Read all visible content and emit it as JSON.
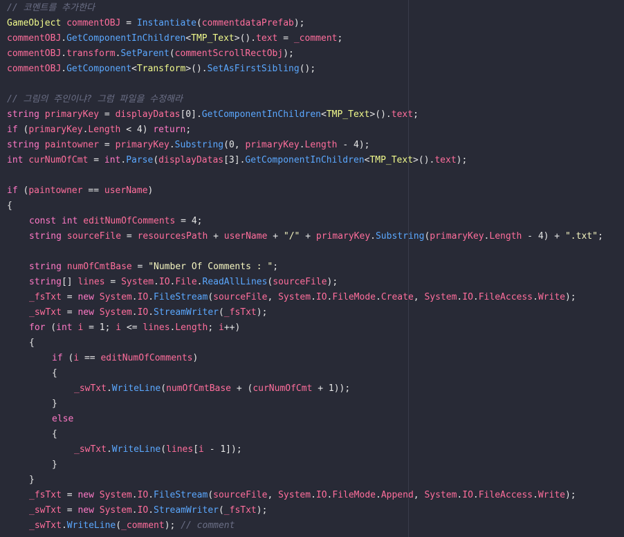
{
  "colors": {
    "background": "#282a36",
    "comment": "#6b6f86",
    "keyword": "#ff79c6",
    "type": "#f1fa8c",
    "variable": "#ff6e9c",
    "method": "#5ba8ff",
    "plain": "#e6e6e6"
  },
  "code_lines": [
    {
      "indent": 0,
      "tokens": [
        {
          "t": "// 코멘트를 추가한다",
          "c": "cm"
        }
      ]
    },
    {
      "indent": 0,
      "tokens": [
        {
          "t": "GameObject",
          "c": "ty"
        },
        {
          "t": " ",
          "c": "pl"
        },
        {
          "t": "commentOBJ",
          "c": "vr"
        },
        {
          "t": " = ",
          "c": "op"
        },
        {
          "t": "Instantiate",
          "c": "fn"
        },
        {
          "t": "(",
          "c": "pl"
        },
        {
          "t": "commentdataPrefab",
          "c": "vr"
        },
        {
          "t": ");",
          "c": "pl"
        }
      ]
    },
    {
      "indent": 0,
      "tokens": [
        {
          "t": "commentOBJ",
          "c": "vr"
        },
        {
          "t": ".",
          "c": "pl"
        },
        {
          "t": "GetComponentInChildren",
          "c": "fn"
        },
        {
          "t": "<",
          "c": "pl"
        },
        {
          "t": "TMP_Text",
          "c": "ty"
        },
        {
          "t": ">().",
          "c": "pl"
        },
        {
          "t": "text",
          "c": "vr"
        },
        {
          "t": " = ",
          "c": "op"
        },
        {
          "t": "_comment",
          "c": "vr"
        },
        {
          "t": ";",
          "c": "pl"
        }
      ]
    },
    {
      "indent": 0,
      "tokens": [
        {
          "t": "commentOBJ",
          "c": "vr"
        },
        {
          "t": ".",
          "c": "pl"
        },
        {
          "t": "transform",
          "c": "vr"
        },
        {
          "t": ".",
          "c": "pl"
        },
        {
          "t": "SetParent",
          "c": "fn"
        },
        {
          "t": "(",
          "c": "pl"
        },
        {
          "t": "commentScrollRectObj",
          "c": "vr"
        },
        {
          "t": ");",
          "c": "pl"
        }
      ]
    },
    {
      "indent": 0,
      "tokens": [
        {
          "t": "commentOBJ",
          "c": "vr"
        },
        {
          "t": ".",
          "c": "pl"
        },
        {
          "t": "GetComponent",
          "c": "fn"
        },
        {
          "t": "<",
          "c": "pl"
        },
        {
          "t": "Transform",
          "c": "ty"
        },
        {
          "t": ">().",
          "c": "pl"
        },
        {
          "t": "SetAsFirstSibling",
          "c": "fn"
        },
        {
          "t": "();",
          "c": "pl"
        }
      ]
    },
    {
      "indent": 0,
      "tokens": []
    },
    {
      "indent": 0,
      "tokens": [
        {
          "t": "// 그림의 주인이냐? 그럼 파일을 수정해라",
          "c": "cm"
        }
      ]
    },
    {
      "indent": 0,
      "tokens": [
        {
          "t": "string",
          "c": "kw"
        },
        {
          "t": " ",
          "c": "pl"
        },
        {
          "t": "primaryKey",
          "c": "vr"
        },
        {
          "t": " = ",
          "c": "op"
        },
        {
          "t": "displayDatas",
          "c": "vr"
        },
        {
          "t": "[0].",
          "c": "pl"
        },
        {
          "t": "GetComponentInChildren",
          "c": "fn"
        },
        {
          "t": "<",
          "c": "pl"
        },
        {
          "t": "TMP_Text",
          "c": "ty"
        },
        {
          "t": ">().",
          "c": "pl"
        },
        {
          "t": "text",
          "c": "vr"
        },
        {
          "t": ";",
          "c": "pl"
        }
      ]
    },
    {
      "indent": 0,
      "tokens": [
        {
          "t": "if",
          "c": "kw"
        },
        {
          "t": " (",
          "c": "pl"
        },
        {
          "t": "primaryKey",
          "c": "vr"
        },
        {
          "t": ".",
          "c": "pl"
        },
        {
          "t": "Length",
          "c": "vr"
        },
        {
          "t": " < 4) ",
          "c": "pl"
        },
        {
          "t": "return",
          "c": "kw"
        },
        {
          "t": ";",
          "c": "pl"
        }
      ]
    },
    {
      "indent": 0,
      "tokens": [
        {
          "t": "string",
          "c": "kw"
        },
        {
          "t": " ",
          "c": "pl"
        },
        {
          "t": "paintowner",
          "c": "vr"
        },
        {
          "t": " = ",
          "c": "op"
        },
        {
          "t": "primaryKey",
          "c": "vr"
        },
        {
          "t": ".",
          "c": "pl"
        },
        {
          "t": "Substring",
          "c": "fn"
        },
        {
          "t": "(0, ",
          "c": "pl"
        },
        {
          "t": "primaryKey",
          "c": "vr"
        },
        {
          "t": ".",
          "c": "pl"
        },
        {
          "t": "Length",
          "c": "vr"
        },
        {
          "t": " - 4);",
          "c": "pl"
        }
      ]
    },
    {
      "indent": 0,
      "tokens": [
        {
          "t": "int",
          "c": "kw"
        },
        {
          "t": " ",
          "c": "pl"
        },
        {
          "t": "curNumOfCmt",
          "c": "vr"
        },
        {
          "t": " = ",
          "c": "op"
        },
        {
          "t": "int",
          "c": "kw"
        },
        {
          "t": ".",
          "c": "pl"
        },
        {
          "t": "Parse",
          "c": "fn"
        },
        {
          "t": "(",
          "c": "pl"
        },
        {
          "t": "displayDatas",
          "c": "vr"
        },
        {
          "t": "[3].",
          "c": "pl"
        },
        {
          "t": "GetComponentInChildren",
          "c": "fn"
        },
        {
          "t": "<",
          "c": "pl"
        },
        {
          "t": "TMP_Text",
          "c": "ty"
        },
        {
          "t": ">().",
          "c": "pl"
        },
        {
          "t": "text",
          "c": "vr"
        },
        {
          "t": ");",
          "c": "pl"
        }
      ]
    },
    {
      "indent": 0,
      "tokens": []
    },
    {
      "indent": 0,
      "tokens": [
        {
          "t": "if",
          "c": "kw"
        },
        {
          "t": " (",
          "c": "pl"
        },
        {
          "t": "paintowner",
          "c": "vr"
        },
        {
          "t": " == ",
          "c": "op"
        },
        {
          "t": "userName",
          "c": "vr"
        },
        {
          "t": ")",
          "c": "pl"
        }
      ]
    },
    {
      "indent": 0,
      "tokens": [
        {
          "t": "{",
          "c": "pl"
        }
      ]
    },
    {
      "indent": 1,
      "tokens": [
        {
          "t": "const",
          "c": "kw"
        },
        {
          "t": " ",
          "c": "pl"
        },
        {
          "t": "int",
          "c": "kw"
        },
        {
          "t": " ",
          "c": "pl"
        },
        {
          "t": "editNumOfComments",
          "c": "vr"
        },
        {
          "t": " = 4;",
          "c": "pl"
        }
      ]
    },
    {
      "indent": 1,
      "tokens": [
        {
          "t": "string",
          "c": "kw"
        },
        {
          "t": " ",
          "c": "pl"
        },
        {
          "t": "sourceFile",
          "c": "vr"
        },
        {
          "t": " = ",
          "c": "op"
        },
        {
          "t": "resourcesPath",
          "c": "vr"
        },
        {
          "t": " + ",
          "c": "op"
        },
        {
          "t": "userName",
          "c": "vr"
        },
        {
          "t": " + ",
          "c": "op"
        },
        {
          "t": "\"/\"",
          "c": "st"
        },
        {
          "t": " + ",
          "c": "op"
        },
        {
          "t": "primaryKey",
          "c": "vr"
        },
        {
          "t": ".",
          "c": "pl"
        },
        {
          "t": "Substring",
          "c": "fn"
        },
        {
          "t": "(",
          "c": "pl"
        },
        {
          "t": "primaryKey",
          "c": "vr"
        },
        {
          "t": ".",
          "c": "pl"
        },
        {
          "t": "Length",
          "c": "vr"
        },
        {
          "t": " - 4) + ",
          "c": "pl"
        },
        {
          "t": "\".txt\"",
          "c": "st"
        },
        {
          "t": ";",
          "c": "pl"
        }
      ]
    },
    {
      "indent": 1,
      "tokens": []
    },
    {
      "indent": 1,
      "tokens": [
        {
          "t": "string",
          "c": "kw"
        },
        {
          "t": " ",
          "c": "pl"
        },
        {
          "t": "numOfCmtBase",
          "c": "vr"
        },
        {
          "t": " = ",
          "c": "op"
        },
        {
          "t": "\"Number Of Comments : \"",
          "c": "st"
        },
        {
          "t": ";",
          "c": "pl"
        }
      ]
    },
    {
      "indent": 1,
      "tokens": [
        {
          "t": "string",
          "c": "kw"
        },
        {
          "t": "[] ",
          "c": "pl"
        },
        {
          "t": "lines",
          "c": "vr"
        },
        {
          "t": " = ",
          "c": "op"
        },
        {
          "t": "System",
          "c": "vr"
        },
        {
          "t": ".",
          "c": "pl"
        },
        {
          "t": "IO",
          "c": "vr"
        },
        {
          "t": ".",
          "c": "pl"
        },
        {
          "t": "File",
          "c": "vr"
        },
        {
          "t": ".",
          "c": "pl"
        },
        {
          "t": "ReadAllLines",
          "c": "fn"
        },
        {
          "t": "(",
          "c": "pl"
        },
        {
          "t": "sourceFile",
          "c": "vr"
        },
        {
          "t": ");",
          "c": "pl"
        }
      ]
    },
    {
      "indent": 1,
      "tokens": [
        {
          "t": "_fsTxt",
          "c": "vr"
        },
        {
          "t": " = ",
          "c": "op"
        },
        {
          "t": "new",
          "c": "kw"
        },
        {
          "t": " ",
          "c": "pl"
        },
        {
          "t": "System",
          "c": "vr"
        },
        {
          "t": ".",
          "c": "pl"
        },
        {
          "t": "IO",
          "c": "vr"
        },
        {
          "t": ".",
          "c": "pl"
        },
        {
          "t": "FileStream",
          "c": "fn"
        },
        {
          "t": "(",
          "c": "pl"
        },
        {
          "t": "sourceFile",
          "c": "vr"
        },
        {
          "t": ", ",
          "c": "pl"
        },
        {
          "t": "System",
          "c": "vr"
        },
        {
          "t": ".",
          "c": "pl"
        },
        {
          "t": "IO",
          "c": "vr"
        },
        {
          "t": ".",
          "c": "pl"
        },
        {
          "t": "FileMode",
          "c": "vr"
        },
        {
          "t": ".",
          "c": "pl"
        },
        {
          "t": "Create",
          "c": "vr"
        },
        {
          "t": ", ",
          "c": "pl"
        },
        {
          "t": "System",
          "c": "vr"
        },
        {
          "t": ".",
          "c": "pl"
        },
        {
          "t": "IO",
          "c": "vr"
        },
        {
          "t": ".",
          "c": "pl"
        },
        {
          "t": "FileAccess",
          "c": "vr"
        },
        {
          "t": ".",
          "c": "pl"
        },
        {
          "t": "Write",
          "c": "vr"
        },
        {
          "t": ");",
          "c": "pl"
        }
      ]
    },
    {
      "indent": 1,
      "tokens": [
        {
          "t": "_swTxt",
          "c": "vr"
        },
        {
          "t": " = ",
          "c": "op"
        },
        {
          "t": "new",
          "c": "kw"
        },
        {
          "t": " ",
          "c": "pl"
        },
        {
          "t": "System",
          "c": "vr"
        },
        {
          "t": ".",
          "c": "pl"
        },
        {
          "t": "IO",
          "c": "vr"
        },
        {
          "t": ".",
          "c": "pl"
        },
        {
          "t": "StreamWriter",
          "c": "fn"
        },
        {
          "t": "(",
          "c": "pl"
        },
        {
          "t": "_fsTxt",
          "c": "vr"
        },
        {
          "t": ");",
          "c": "pl"
        }
      ]
    },
    {
      "indent": 1,
      "tokens": [
        {
          "t": "for",
          "c": "kw"
        },
        {
          "t": " (",
          "c": "pl"
        },
        {
          "t": "int",
          "c": "kw"
        },
        {
          "t": " ",
          "c": "pl"
        },
        {
          "t": "i",
          "c": "vr"
        },
        {
          "t": " = 1; ",
          "c": "pl"
        },
        {
          "t": "i",
          "c": "vr"
        },
        {
          "t": " <= ",
          "c": "op"
        },
        {
          "t": "lines",
          "c": "vr"
        },
        {
          "t": ".",
          "c": "pl"
        },
        {
          "t": "Length",
          "c": "vr"
        },
        {
          "t": "; ",
          "c": "pl"
        },
        {
          "t": "i",
          "c": "vr"
        },
        {
          "t": "++)",
          "c": "pl"
        }
      ]
    },
    {
      "indent": 1,
      "tokens": [
        {
          "t": "{",
          "c": "pl"
        }
      ]
    },
    {
      "indent": 2,
      "tokens": [
        {
          "t": "if",
          "c": "kw"
        },
        {
          "t": " (",
          "c": "pl"
        },
        {
          "t": "i",
          "c": "vr"
        },
        {
          "t": " == ",
          "c": "op"
        },
        {
          "t": "editNumOfComments",
          "c": "vr"
        },
        {
          "t": ")",
          "c": "pl"
        }
      ]
    },
    {
      "indent": 2,
      "tokens": [
        {
          "t": "{",
          "c": "pl"
        }
      ]
    },
    {
      "indent": 3,
      "tokens": [
        {
          "t": "_swTxt",
          "c": "vr"
        },
        {
          "t": ".",
          "c": "pl"
        },
        {
          "t": "WriteLine",
          "c": "fn"
        },
        {
          "t": "(",
          "c": "pl"
        },
        {
          "t": "numOfCmtBase",
          "c": "vr"
        },
        {
          "t": " + (",
          "c": "op"
        },
        {
          "t": "curNumOfCmt",
          "c": "vr"
        },
        {
          "t": " + 1));",
          "c": "pl"
        }
      ]
    },
    {
      "indent": 2,
      "tokens": [
        {
          "t": "}",
          "c": "pl"
        }
      ]
    },
    {
      "indent": 2,
      "tokens": [
        {
          "t": "else",
          "c": "kw"
        }
      ]
    },
    {
      "indent": 2,
      "tokens": [
        {
          "t": "{",
          "c": "pl"
        }
      ]
    },
    {
      "indent": 3,
      "tokens": [
        {
          "t": "_swTxt",
          "c": "vr"
        },
        {
          "t": ".",
          "c": "pl"
        },
        {
          "t": "WriteLine",
          "c": "fn"
        },
        {
          "t": "(",
          "c": "pl"
        },
        {
          "t": "lines",
          "c": "vr"
        },
        {
          "t": "[",
          "c": "pl"
        },
        {
          "t": "i",
          "c": "vr"
        },
        {
          "t": " - 1]);",
          "c": "pl"
        }
      ]
    },
    {
      "indent": 2,
      "tokens": [
        {
          "t": "}",
          "c": "pl"
        }
      ]
    },
    {
      "indent": 1,
      "tokens": [
        {
          "t": "}",
          "c": "pl"
        }
      ]
    },
    {
      "indent": 1,
      "tokens": [
        {
          "t": "_fsTxt",
          "c": "vr"
        },
        {
          "t": " = ",
          "c": "op"
        },
        {
          "t": "new",
          "c": "kw"
        },
        {
          "t": " ",
          "c": "pl"
        },
        {
          "t": "System",
          "c": "vr"
        },
        {
          "t": ".",
          "c": "pl"
        },
        {
          "t": "IO",
          "c": "vr"
        },
        {
          "t": ".",
          "c": "pl"
        },
        {
          "t": "FileStream",
          "c": "fn"
        },
        {
          "t": "(",
          "c": "pl"
        },
        {
          "t": "sourceFile",
          "c": "vr"
        },
        {
          "t": ", ",
          "c": "pl"
        },
        {
          "t": "System",
          "c": "vr"
        },
        {
          "t": ".",
          "c": "pl"
        },
        {
          "t": "IO",
          "c": "vr"
        },
        {
          "t": ".",
          "c": "pl"
        },
        {
          "t": "FileMode",
          "c": "vr"
        },
        {
          "t": ".",
          "c": "pl"
        },
        {
          "t": "Append",
          "c": "vr"
        },
        {
          "t": ", ",
          "c": "pl"
        },
        {
          "t": "System",
          "c": "vr"
        },
        {
          "t": ".",
          "c": "pl"
        },
        {
          "t": "IO",
          "c": "vr"
        },
        {
          "t": ".",
          "c": "pl"
        },
        {
          "t": "FileAccess",
          "c": "vr"
        },
        {
          "t": ".",
          "c": "pl"
        },
        {
          "t": "Write",
          "c": "vr"
        },
        {
          "t": ");",
          "c": "pl"
        }
      ]
    },
    {
      "indent": 1,
      "tokens": [
        {
          "t": "_swTxt",
          "c": "vr"
        },
        {
          "t": " = ",
          "c": "op"
        },
        {
          "t": "new",
          "c": "kw"
        },
        {
          "t": " ",
          "c": "pl"
        },
        {
          "t": "System",
          "c": "vr"
        },
        {
          "t": ".",
          "c": "pl"
        },
        {
          "t": "IO",
          "c": "vr"
        },
        {
          "t": ".",
          "c": "pl"
        },
        {
          "t": "StreamWriter",
          "c": "fn"
        },
        {
          "t": "(",
          "c": "pl"
        },
        {
          "t": "_fsTxt",
          "c": "vr"
        },
        {
          "t": ");",
          "c": "pl"
        }
      ]
    },
    {
      "indent": 1,
      "tokens": [
        {
          "t": "_swTxt",
          "c": "vr"
        },
        {
          "t": ".",
          "c": "pl"
        },
        {
          "t": "WriteLine",
          "c": "fn"
        },
        {
          "t": "(",
          "c": "pl"
        },
        {
          "t": "_comment",
          "c": "vr"
        },
        {
          "t": "); ",
          "c": "pl"
        },
        {
          "t": "// comment",
          "c": "cm"
        }
      ]
    }
  ]
}
